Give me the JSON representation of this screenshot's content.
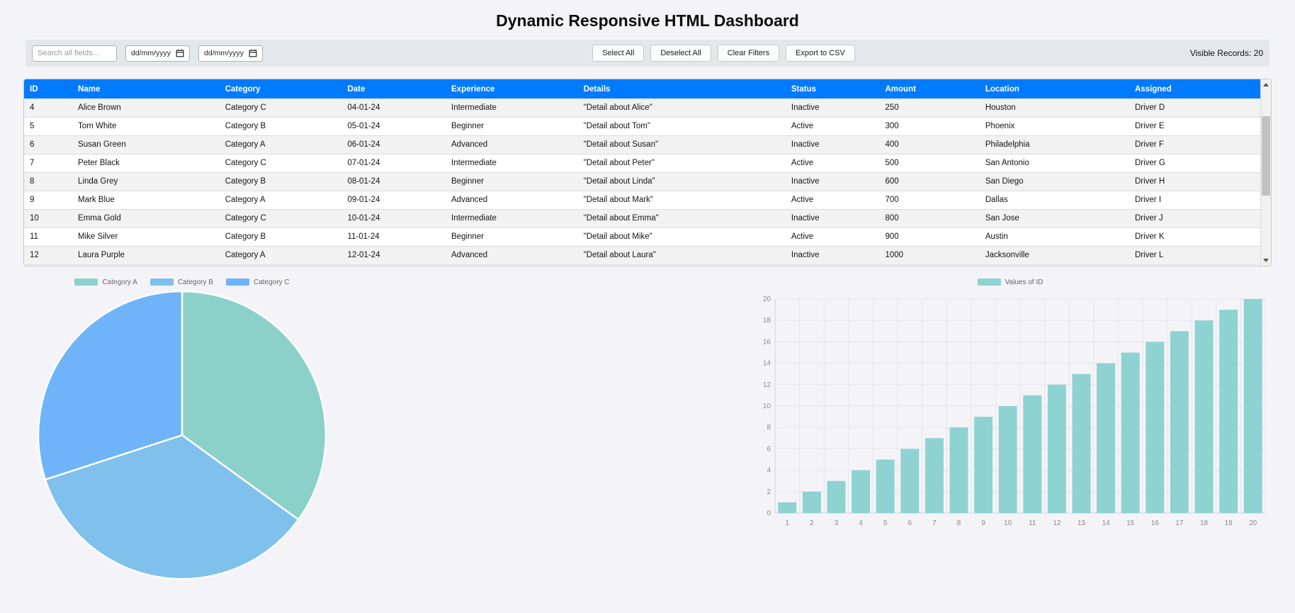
{
  "page": {
    "title": "Dynamic Responsive HTML Dashboard",
    "background": "#f4f4f8"
  },
  "toolbar": {
    "search_placeholder": "Search all fields...",
    "date_from_placeholder": "dd/mm/yyyy",
    "date_to_placeholder": "dd/mm/yyyy",
    "buttons": [
      "Select All",
      "Deselect All",
      "Clear Filters",
      "Export to CSV"
    ],
    "visible_records": "Visible Records: 20"
  },
  "table": {
    "header_color": "#007bff",
    "columns": [
      "ID",
      "Name",
      "Category",
      "Date",
      "Experience",
      "Details",
      "Status",
      "Amount",
      "Location",
      "Assigned"
    ],
    "rows": [
      [
        "4",
        "Alice Brown",
        "Category C",
        "04-01-24",
        "Intermediate",
        "\"Detail about Alice\"",
        "Inactive",
        "250",
        "Houston",
        "Driver D"
      ],
      [
        "5",
        "Tom White",
        "Category B",
        "05-01-24",
        "Beginner",
        "\"Detail about Tom\"",
        "Active",
        "300",
        "Phoenix",
        "Driver E"
      ],
      [
        "6",
        "Susan Green",
        "Category A",
        "06-01-24",
        "Advanced",
        "\"Detail about Susan\"",
        "Inactive",
        "400",
        "Philadelphia",
        "Driver F"
      ],
      [
        "7",
        "Peter Black",
        "Category C",
        "07-01-24",
        "Intermediate",
        "\"Detail about Peter\"",
        "Active",
        "500",
        "San Antonio",
        "Driver G"
      ],
      [
        "8",
        "Linda Grey",
        "Category B",
        "08-01-24",
        "Beginner",
        "\"Detail about Linda\"",
        "Inactive",
        "600",
        "San Diego",
        "Driver H"
      ],
      [
        "9",
        "Mark Blue",
        "Category A",
        "09-01-24",
        "Advanced",
        "\"Detail about Mark\"",
        "Active",
        "700",
        "Dallas",
        "Driver I"
      ],
      [
        "10",
        "Emma Gold",
        "Category C",
        "10-01-24",
        "Intermediate",
        "\"Detail about Emma\"",
        "Inactive",
        "800",
        "San Jose",
        "Driver J"
      ],
      [
        "11",
        "Mike Silver",
        "Category B",
        "11-01-24",
        "Beginner",
        "\"Detail about Mike\"",
        "Active",
        "900",
        "Austin",
        "Driver K"
      ],
      [
        "12",
        "Laura Purple",
        "Category A",
        "12-01-24",
        "Advanced",
        "\"Detail about Laura\"",
        "Inactive",
        "1000",
        "Jacksonville",
        "Driver L"
      ]
    ]
  },
  "chart_data": [
    {
      "type": "pie",
      "labels": [
        "Category A",
        "Category B",
        "Category C"
      ],
      "values": [
        7,
        7,
        6
      ],
      "colors": [
        "#8bd1ca",
        "#7fc0ed",
        "#6fb4f8"
      ],
      "legend_position": "top",
      "start_angle_deg": 0,
      "total": 20
    },
    {
      "type": "bar",
      "legend": "Values of ID",
      "categories": [
        1,
        2,
        3,
        4,
        5,
        6,
        7,
        8,
        9,
        10,
        11,
        12,
        13,
        14,
        15,
        16,
        17,
        18,
        19,
        20
      ],
      "values": [
        1,
        2,
        3,
        4,
        5,
        6,
        7,
        8,
        9,
        10,
        11,
        12,
        13,
        14,
        15,
        16,
        17,
        18,
        19,
        20
      ],
      "color": "#8ed3d2",
      "xlabel": "",
      "ylabel": "",
      "ylim": [
        0,
        20
      ],
      "ytick_step": 2,
      "grid": true,
      "legend_position": "top"
    }
  ]
}
